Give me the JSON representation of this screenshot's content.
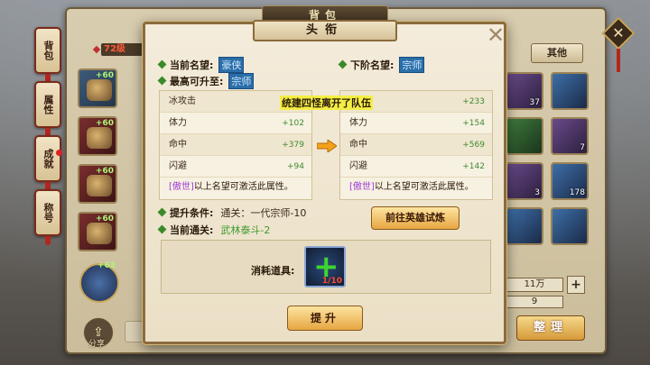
{
  "bag_window": {
    "title": "背包",
    "level_badge": "72级",
    "other_tab": "其他",
    "share_label": "分享",
    "sort_label": "整理",
    "money": "11万",
    "count": "9"
  },
  "side_tabs": [
    {
      "label": "背包"
    },
    {
      "label": "属性"
    },
    {
      "label": "成就"
    },
    {
      "label": "称号"
    }
  ],
  "left_slots": [
    {
      "plus": "+60"
    },
    {
      "plus": "+60"
    },
    {
      "plus": "+60"
    },
    {
      "plus": "+60"
    },
    {
      "plus": "+62"
    }
  ],
  "right_slots": [
    {
      "count": "37"
    },
    {
      "count": ""
    },
    {
      "count": ""
    },
    {
      "count": "7"
    },
    {
      "count": "3"
    },
    {
      "count": "178"
    },
    {
      "count": ""
    },
    {
      "count": ""
    }
  ],
  "modal": {
    "title": "头衔",
    "close_glyph": "✕",
    "current_rank_label": "当前名望:",
    "current_rank": "豪侠",
    "next_rank_label": "下阶名望:",
    "next_rank": "宗师",
    "max_rank_label": "最高可升至:",
    "max_rank": "宗师",
    "toast": "统建四怪离开了队伍",
    "left_stats": [
      {
        "name": "冰攻击",
        "value": ""
      },
      {
        "name": "体力",
        "value": "+102"
      },
      {
        "name": "命中",
        "value": "+379"
      },
      {
        "name": "闪避",
        "value": "+94"
      }
    ],
    "right_stats": [
      {
        "name": "",
        "value": "+233"
      },
      {
        "name": "体力",
        "value": "+154"
      },
      {
        "name": "命中",
        "value": "+569"
      },
      {
        "name": "闪避",
        "value": "+142"
      }
    ],
    "note_tag": "[傲世]",
    "note_text": "以上名望可激活此属性。",
    "upgrade_condition_label": "提升条件:",
    "upgrade_condition_value": "通关：一代宗师-10",
    "current_level_label": "当前通关:",
    "current_level_value": "武林泰斗-2",
    "trial_button": "前往英雄试炼",
    "consume_label": "消耗道具:",
    "consume_count": "1/10",
    "upgrade_button": "提升"
  }
}
